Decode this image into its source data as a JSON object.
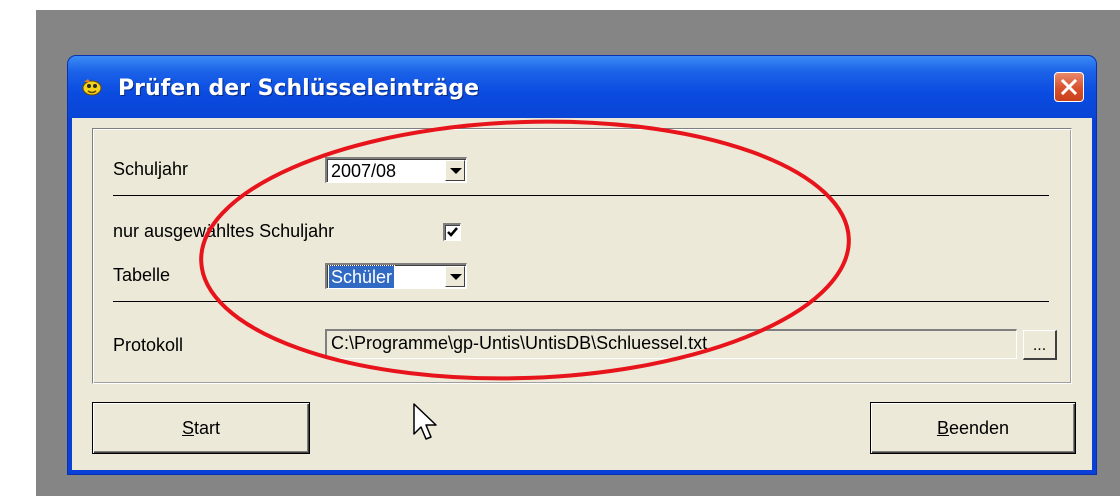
{
  "window": {
    "title": "Prüfen der Schlüsseleinträge",
    "close_label": "Close"
  },
  "form": {
    "schuljahr_label": "Schuljahr",
    "schuljahr_value": "2007/08",
    "nur_ausgewaehltes_label": "nur ausgewähltes Schuljahr",
    "nur_ausgewaehltes_checked": true,
    "tabelle_label": "Tabelle",
    "tabelle_value": "Schüler",
    "protokoll_label": "Protokoll",
    "protokoll_value": "C:\\Programme\\gp-Untis\\UntisDB\\Schluessel.txt",
    "browse_label": "..."
  },
  "buttons": {
    "start_mnemonic": "S",
    "start_rest": "tart",
    "beenden_mnemonic": "B",
    "beenden_rest": "eenden"
  },
  "colors": {
    "titlebar": "#0a4be0",
    "dialog_bg": "#ece9d8",
    "annotation": "#e8141c",
    "selection": "#316ac5"
  },
  "icons": {
    "app": "app-icon",
    "close": "close-icon",
    "checkmark": "checkmark-icon",
    "dropdown": "chevron-down-icon",
    "cursor": "mouse-pointer-icon",
    "annotation": "red-ellipse-annotation"
  }
}
